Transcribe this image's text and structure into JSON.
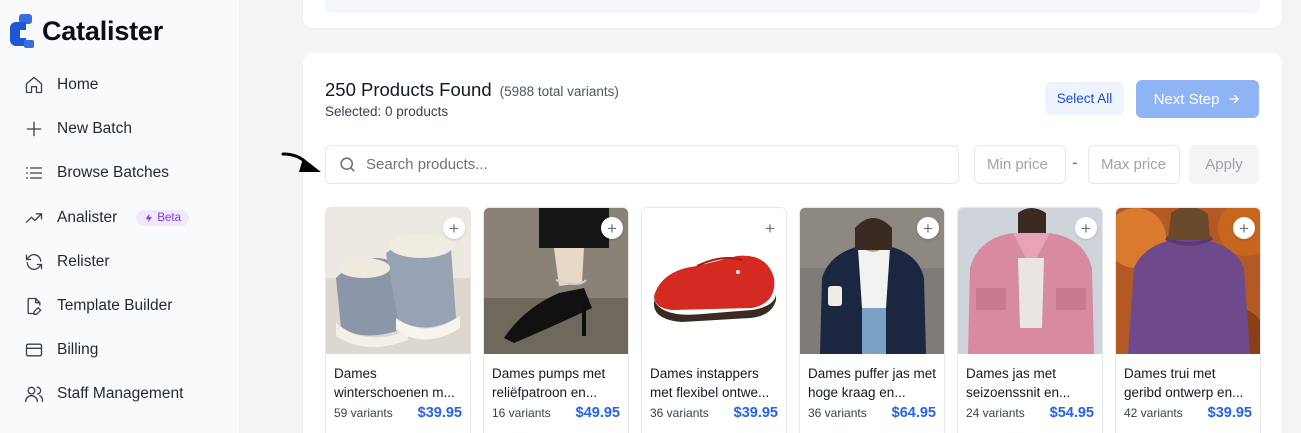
{
  "app": {
    "name": "Catalister"
  },
  "sidebar": {
    "items": [
      {
        "label": "Home",
        "icon": "home-icon"
      },
      {
        "label": "New Batch",
        "icon": "plus-icon"
      },
      {
        "label": "Browse Batches",
        "icon": "list-icon"
      },
      {
        "label": "Analister",
        "icon": "trending-icon",
        "badge": "Beta"
      },
      {
        "label": "Relister",
        "icon": "refresh-icon"
      },
      {
        "label": "Template Builder",
        "icon": "file-edit-icon"
      },
      {
        "label": "Billing",
        "icon": "credit-card-icon"
      },
      {
        "label": "Staff Management",
        "icon": "users-icon"
      }
    ]
  },
  "results": {
    "title": "250 Products Found",
    "subtitle": "(5988 total variants)",
    "selected": "Selected: 0 products"
  },
  "actions": {
    "select_all": "Select All",
    "next_step": "Next Step"
  },
  "filters": {
    "search_placeholder": "Search products...",
    "min_placeholder": "Min price",
    "max_placeholder": "Max price",
    "dash": "-",
    "apply": "Apply"
  },
  "products": [
    {
      "name": "Dames winterschoenen m...",
      "variants": "59 variants",
      "price": "$39.95"
    },
    {
      "name": "Dames pumps met reliëfpatroon en...",
      "variants": "16 variants",
      "price": "$49.95"
    },
    {
      "name": "Dames instappers met flexibel ontwe...",
      "variants": "36 variants",
      "price": "$39.95"
    },
    {
      "name": "Dames puffer jas met hoge kraag en...",
      "variants": "36 variants",
      "price": "$64.95"
    },
    {
      "name": "Dames jas met seizoenssnit en...",
      "variants": "24 variants",
      "price": "$54.95"
    },
    {
      "name": "Dames trui met geribd ontwerp en...",
      "variants": "42 variants",
      "price": "$39.95"
    }
  ],
  "colors": {
    "accent": "#2563eb",
    "next_button": "#8fb4f5",
    "beta_bg": "#f1e8fd",
    "beta_text": "#7c3aed"
  }
}
